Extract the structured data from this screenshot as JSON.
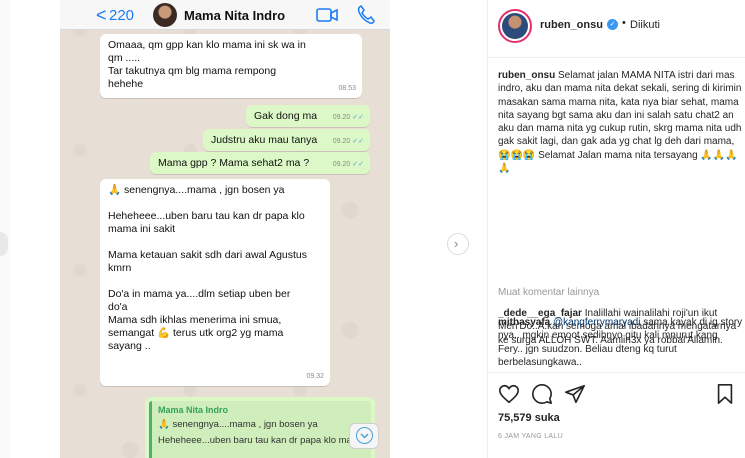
{
  "chat": {
    "back_chevron": "<",
    "back_count": "220",
    "contact_name": "Mama Nita Indro",
    "icons": [
      "video-icon",
      "phone-icon"
    ],
    "messages": [
      {
        "dir": "in",
        "text": "Omaaa,  qm gpp kan klo mama ini sk wa in\nqm .....\nTar takutnya qm blg mama rempong\nhehehe",
        "time": "08.53"
      },
      {
        "dir": "out",
        "text": "Gak dong ma",
        "time": "09.20"
      },
      {
        "dir": "out",
        "text": "Judstru aku mau tanya",
        "time": "09.20"
      },
      {
        "dir": "out",
        "text": "Mama gpp ? Mama sehat2 ma ?",
        "time": "09.20"
      },
      {
        "dir": "in",
        "text": "🙏 senengnya....mama ,  jgn bosen ya\n\nHeheheee...uben baru tau kan dr papa klo\nmama ini sakit\n\nMama ketauan sakit sdh dari awal Agustus\nkmrn\n\nDo'a in mama ya....dlm setiap uben ber\ndo'a\nMama sdh ikhlas menerima ini smua,\nsemangat 💪 terus utk org2 yg mama\nsayang ..",
        "time": "09.32"
      }
    ],
    "quoted": {
      "name": "Mama Nita Indro",
      "line1": "🙏 senengnya....mama ,  jgn bosen ya",
      "line2": "Heheheee...uben baru tau kan dr papa klo ma..."
    },
    "scroll_icon": "chevron-down-icon"
  },
  "post": {
    "username": "ruben_onsu",
    "verified_mark": "✓",
    "separator": "•",
    "follow_status": "Diikuti",
    "caption": {
      "user": "ruben_onsu",
      "text": "Selamat jalan MAMA NITA istri dari mas indro, aku dan mama nita dekat sekali, sering di kirimin masakan sama mama nita, kata nya biar sehat, mama nita sayang bgt sama aku dan ini salah satu chat2 an aku dan mama nita yg cukup rutin, skrg mama nita udh gak sakit lagi, dan gak ada yg chat lg deh dari mama,😭😭😭 Selamat Jalan mama nita tersayang 🙏🙏🙏🙏"
    },
    "load_more": "Muat komentar lainnya",
    "comments": [
      {
        "user": "_dede__ega_fajar",
        "text": "Inalillahi wainalilahi roji'un ikut Men'Do..A.kan semoga amal ibadahnya mengatarnya ke surga ALLOH SWT. Aamiin3x ya robbal'Allamin."
      },
      {
        "user": "mithasyafa",
        "mention": "@kangferrymaryadi",
        "text": "sama kayak di ig story nya.. mgkin emoot sedihnyo gitu kali mnurut kang Fery.. jgn suudzon. Beliau dteng kq turut berbelasungkawa.."
      }
    ],
    "likes_count": "75,579",
    "likes_label": "suka",
    "time_ago": "6 JAM YANG LALU",
    "icons": [
      "heart-icon",
      "comment-icon",
      "share-icon",
      "bookmark-icon"
    ]
  }
}
